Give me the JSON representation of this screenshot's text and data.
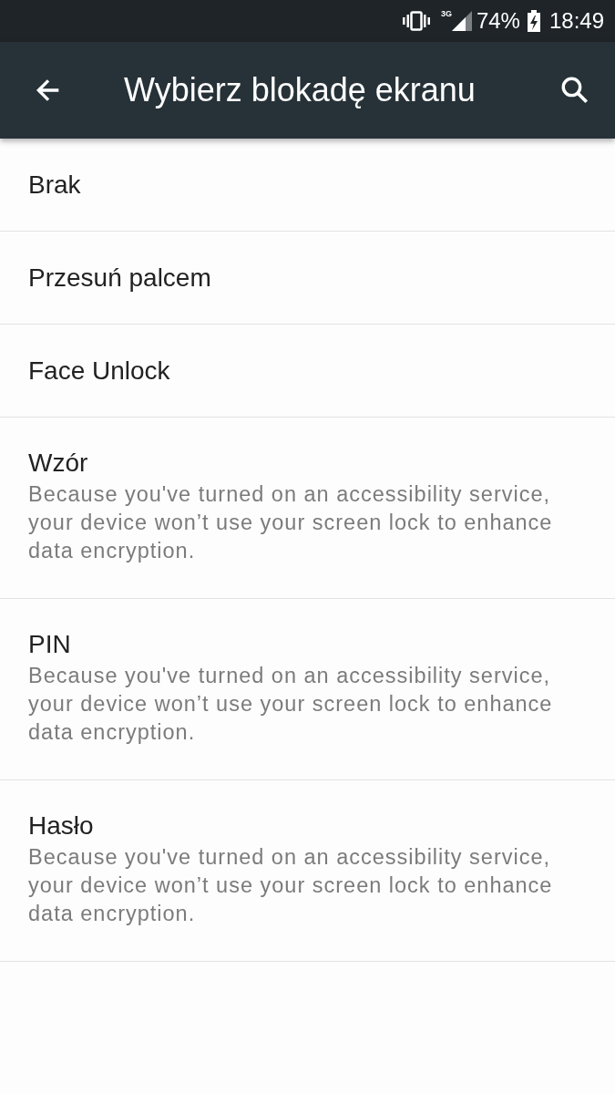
{
  "status_bar": {
    "network": "3G",
    "battery": "74%",
    "time": "18:49"
  },
  "app_bar": {
    "title": "Wybierz blokadę ekranu"
  },
  "options": [
    {
      "title": "Brak"
    },
    {
      "title": "Przesuń palcem"
    },
    {
      "title": "Face Unlock"
    },
    {
      "title": "Wzór",
      "summary": "Because you've turned on an accessibility service, your device won’t use your screen lock to enhance data encryption."
    },
    {
      "title": "PIN",
      "summary": "Because you've turned on an accessibility service, your device won’t use your screen lock to enhance data encryption."
    },
    {
      "title": "Hasło",
      "summary": "Because you've turned on an accessibility service, your device won’t use your screen lock to enhance data encryption."
    }
  ]
}
